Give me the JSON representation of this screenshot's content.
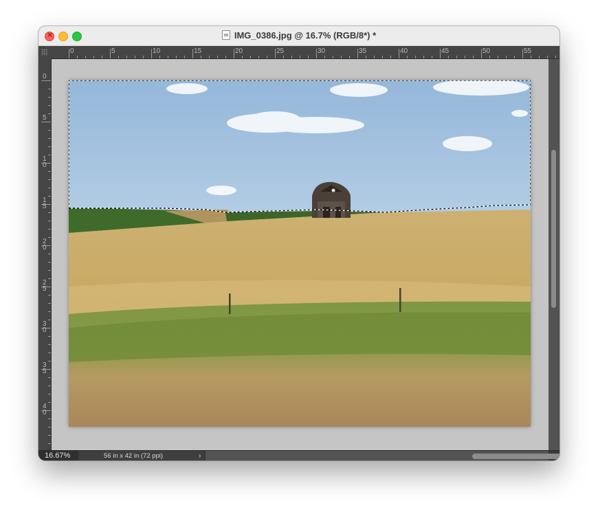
{
  "window": {
    "title": "IMG_0386.jpg @ 16.7% (RGB/8*) *"
  },
  "ruler": {
    "top_labels": [
      "0",
      "5",
      "10",
      "15",
      "20",
      "25",
      "30",
      "35",
      "40",
      "45",
      "50",
      "55"
    ],
    "left_labels": [
      "0",
      "5",
      "10",
      "15",
      "20",
      "25",
      "30",
      "35",
      "40"
    ]
  },
  "canvas": {
    "image_description_name": "barn-landscape-photo",
    "selection": "marching-ants-sky-selection"
  },
  "status": {
    "zoom": "16.67%",
    "doc_info": "56 in x 42 in (72 ppi)",
    "chevron": "›"
  },
  "colors": {
    "workspace": "#535353",
    "pasteboard": "#c5c5c5",
    "sky": "#a3c1de",
    "wheat": "#c7a867",
    "grass": "#6f8a3a"
  }
}
